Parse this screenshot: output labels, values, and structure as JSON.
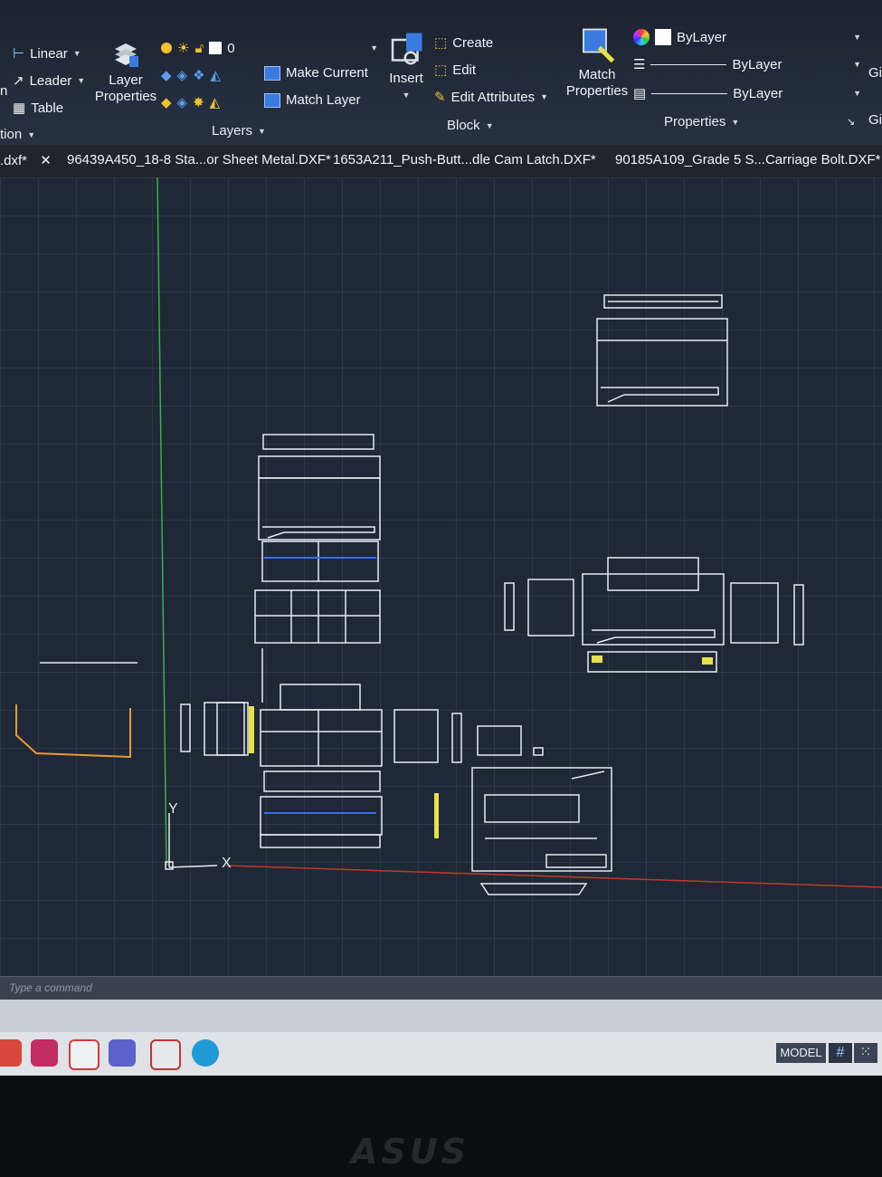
{
  "ribbon": {
    "annotation": {
      "linear_label": "Linear",
      "leader_label": "Leader",
      "table_label": "Table",
      "group_label": "tion"
    },
    "layers": {
      "layer_properties_label": "Layer\nProperties",
      "current_layer_value": "0",
      "make_current_label": "Make Current",
      "match_layer_label": "Match Layer",
      "group_label": "Layers"
    },
    "block": {
      "insert_label": "Insert",
      "create_label": "Create",
      "edit_label": "Edit",
      "edit_attributes_label": "Edit Attributes",
      "group_label": "Block"
    },
    "properties": {
      "match_properties_label": "Match\nProperties",
      "color_value": "ByLayer",
      "linetype_value": "ByLayer",
      "lineweight_value": "ByLayer",
      "group_label": "Properties"
    },
    "partial_left_label": "n",
    "partial_right_top": "Gi",
    "partial_right_bottom": "Gi"
  },
  "tabs": [
    {
      "label": ".dxf*"
    },
    {
      "label": "96439A450_18-8 Sta...or Sheet Metal.DXF*"
    },
    {
      "label": "1653A211_Push-Butt...dle Cam Latch.DXF*"
    },
    {
      "label": "90185A109_Grade 5 S...Carriage Bolt.DXF*"
    }
  ],
  "ucs": {
    "x_label": "X",
    "y_label": "Y"
  },
  "command_line": {
    "placeholder": "Type a command"
  },
  "status_bar": {
    "model_label": "MODEL"
  },
  "monitor": {
    "brand": "ASUS"
  },
  "colors": {
    "ribbon_bg": "#232c3b",
    "canvas_bg": "#1f2836",
    "drawing_lines": "#e6ebf2",
    "y_axis": "#39b04a",
    "x_axis": "#c0392b",
    "orange_part": "#e69a35",
    "highlight_yellow": "#e8e04a",
    "highlight_blue": "#3b6cf0"
  }
}
